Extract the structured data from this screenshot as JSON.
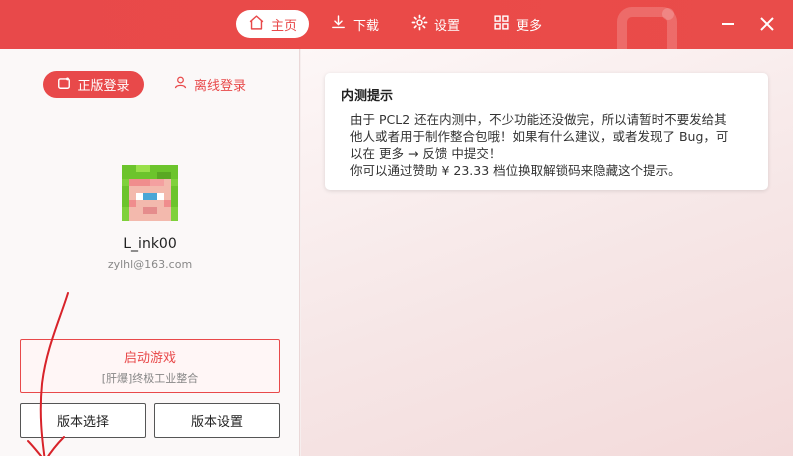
{
  "nav": {
    "home": "主页",
    "download": "下载",
    "settings": "设置",
    "more": "更多"
  },
  "login": {
    "official": "正版登录",
    "offline": "离线登录"
  },
  "profile": {
    "username": "L_ink00",
    "email": "zylhl@163.com"
  },
  "launch": {
    "title": "启动游戏",
    "subtitle": "[肝爆]终极工业整合"
  },
  "version": {
    "select": "版本选择",
    "settings": "版本设置"
  },
  "notice": {
    "title": "内测提示",
    "line1": "由于 PCL2 还在内测中，不少功能还没做完，所以请暂时不要发给其",
    "line2": "他人或者用于制作整合包哦！如果有什么建议，或者发现了 Bug，可",
    "line3": "以在 更多 → 反馈 中提交！",
    "line4": "你可以通过赞助 ¥ 23.33 档位换取解锁码来隐藏这个提示。"
  },
  "colors": {
    "accent": "#e8494a",
    "titlebar": "#e8494a"
  },
  "icons": [
    "home-icon",
    "download-icon",
    "gear-icon",
    "grid-icon",
    "minimize-icon",
    "close-icon",
    "official-login-icon",
    "user-icon"
  ]
}
